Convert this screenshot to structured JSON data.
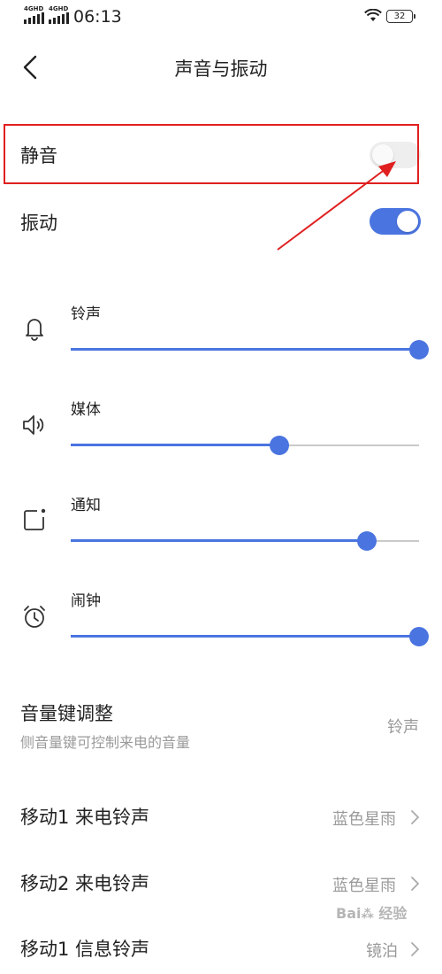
{
  "status_bar": {
    "network_1": "4GHD",
    "network_2": "4GHD",
    "time": "06:13",
    "battery": "32"
  },
  "header": {
    "title": "声音与振动"
  },
  "toggles": {
    "mute_label": "静音",
    "mute_on": false,
    "vibrate_label": "振动",
    "vibrate_on": true
  },
  "volumes": [
    {
      "label": "铃声",
      "icon": "bell-icon",
      "level": 1.0
    },
    {
      "label": "媒体",
      "icon": "speaker-icon",
      "level": 0.6
    },
    {
      "label": "通知",
      "icon": "notification-icon",
      "level": 0.85
    },
    {
      "label": "闹钟",
      "icon": "alarm-clock-icon",
      "level": 1.0
    }
  ],
  "volume_key": {
    "title": "音量键调整",
    "subtitle": "侧音量键可控制来电的音量",
    "value": "铃声"
  },
  "ringtones": [
    {
      "label": "移动1 来电铃声",
      "value": "蓝色星雨"
    },
    {
      "label": "移动2 来电铃声",
      "value": "蓝色星雨"
    },
    {
      "label": "移动1 信息铃声",
      "value": "镜泊"
    }
  ],
  "colors": {
    "accent": "#4a74e0",
    "annotation": "#e02020"
  }
}
